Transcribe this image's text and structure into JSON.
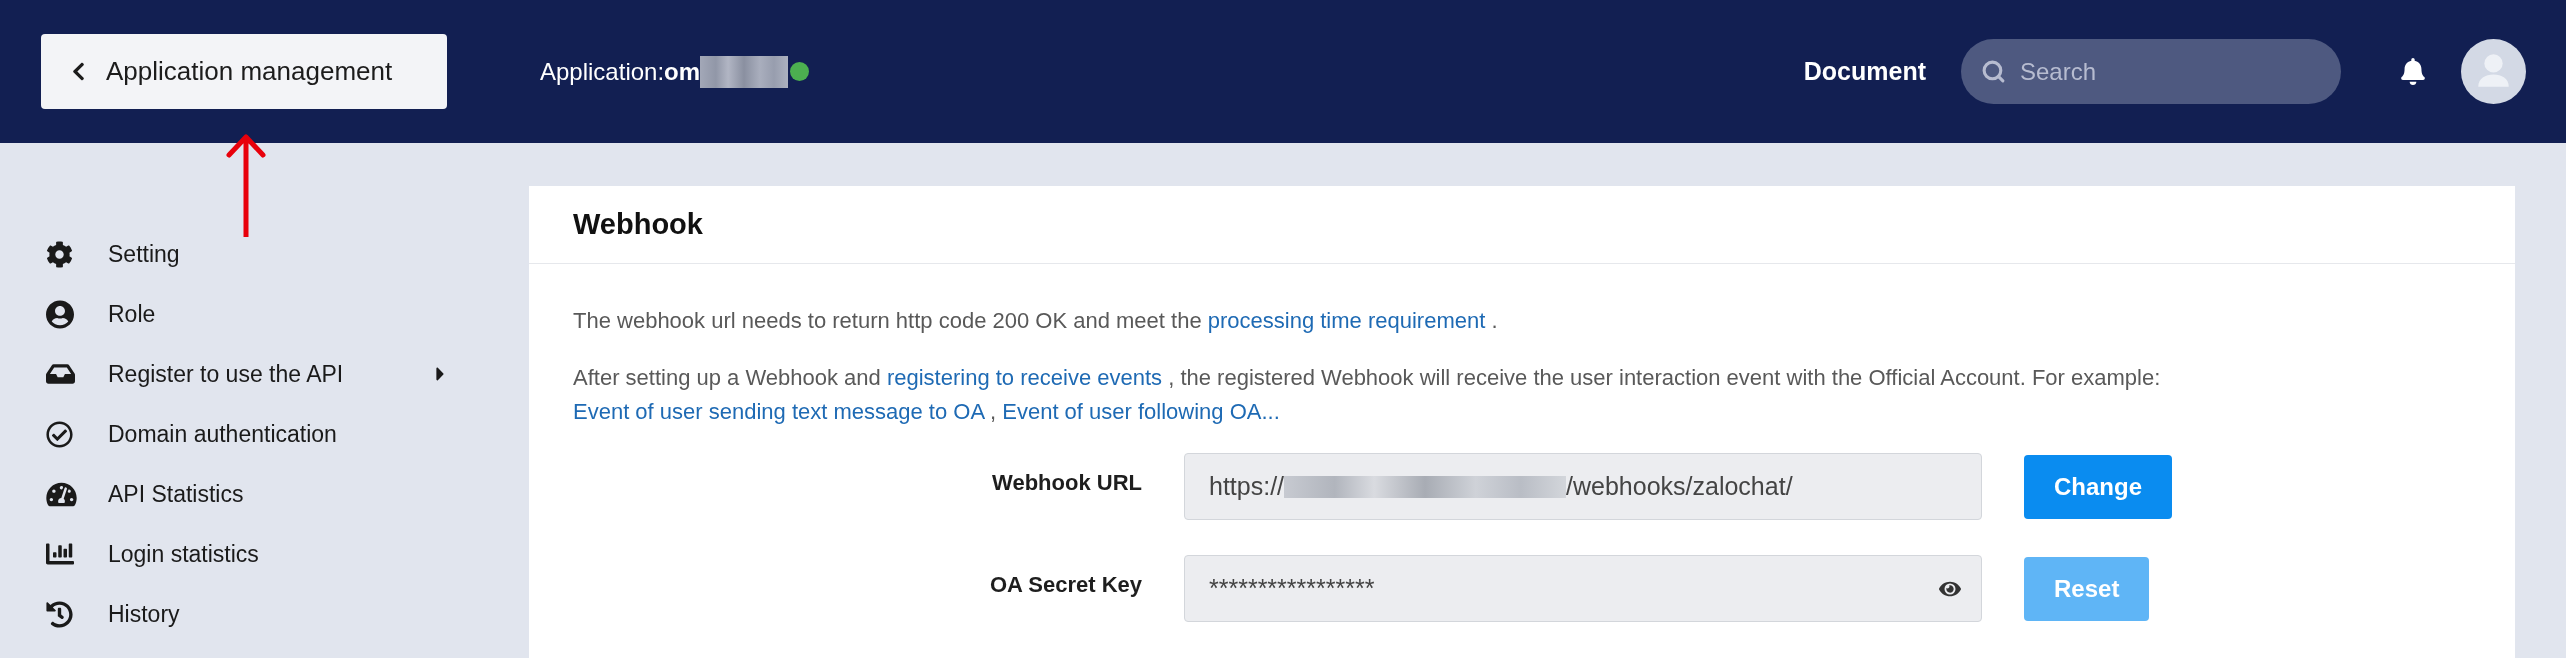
{
  "header": {
    "back_button": "Application management",
    "app_title": "Application:**om**",
    "app_online": true,
    "document_link": "Document",
    "search": {
      "placeholder": "Search"
    }
  },
  "sidebar": {
    "items": [
      {
        "label": "Setting",
        "submenu": false
      },
      {
        "label": "Role",
        "submenu": false
      },
      {
        "label": "Register to use the API",
        "submenu": true
      },
      {
        "label": "Domain authentication",
        "submenu": false
      },
      {
        "label": "API Statistics",
        "submenu": false
      },
      {
        "label": "Login statistics",
        "submenu": false
      },
      {
        "label": "History",
        "submenu": false
      }
    ]
  },
  "webhook_card": {
    "title": "Webhook",
    "paragraphs": [
      {
        "segments": [
          {
            "text": "The webhook url needs to return http code 200 OK and meet the ",
            "link": false
          },
          {
            "text": "processing time requirement",
            "link": true
          },
          {
            "text": " .",
            "link": false
          }
        ]
      },
      {
        "segments": [
          {
            "text": "After setting up a Webhook and ",
            "link": false
          },
          {
            "text": "registering to receive events",
            "link": true
          },
          {
            "text": " , the registered Webhook will receive the user interaction event with the Official Account. For example: ",
            "link": false
          },
          {
            "text": "Event of user sending text message to OA",
            "link": true
          },
          {
            "text": " , ",
            "link": false
          },
          {
            "text": "Event of user following OA...",
            "link": true
          }
        ]
      }
    ],
    "fields": [
      {
        "kind": "url",
        "label": "Webhook URL",
        "value_start": "https://",
        "value_end": "/webhooks/zalochat/",
        "button": {
          "label": "Change",
          "disabled": false
        }
      },
      {
        "kind": "secret",
        "label": "OA Secret Key",
        "value": "*****************",
        "button": {
          "label": "Reset",
          "disabled": true
        }
      }
    ]
  }
}
